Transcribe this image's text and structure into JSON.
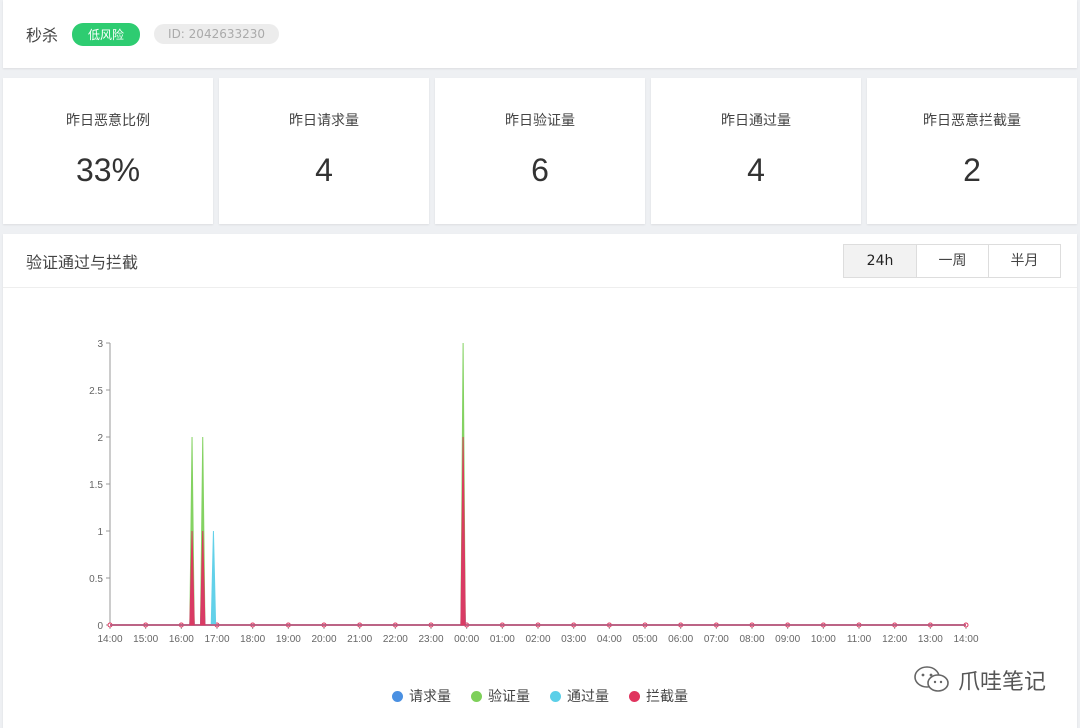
{
  "header": {
    "app_name": "秒杀",
    "risk_label": "低风险",
    "id_label": "ID: 2042633230"
  },
  "stats": [
    {
      "label": "昨日恶意比例",
      "value": "33%"
    },
    {
      "label": "昨日请求量",
      "value": "4"
    },
    {
      "label": "昨日验证量",
      "value": "6"
    },
    {
      "label": "昨日通过量",
      "value": "4"
    },
    {
      "label": "昨日恶意拦截量",
      "value": "2"
    }
  ],
  "chart_panel": {
    "title": "验证通过与拦截",
    "tabs": [
      "24h",
      "一周",
      "半月"
    ],
    "active_tab": "24h"
  },
  "colors": {
    "request": "#4a90e2",
    "verify": "#7ed05a",
    "pass": "#5bcfe8",
    "block": "#e0345e",
    "risk_badge": "#2ecc71"
  },
  "chart_data": {
    "type": "area",
    "x_ticks": [
      "14:00",
      "15:00",
      "16:00",
      "17:00",
      "18:00",
      "19:00",
      "20:00",
      "21:00",
      "22:00",
      "23:00",
      "00:00",
      "01:00",
      "02:00",
      "03:00",
      "04:00",
      "05:00",
      "06:00",
      "07:00",
      "08:00",
      "09:00",
      "10:00",
      "11:00",
      "12:00",
      "13:00",
      "14:00"
    ],
    "y_ticks": [
      "0",
      "0.5",
      "1",
      "1.5",
      "2",
      "2.5",
      "3"
    ],
    "ylim": [
      0,
      3
    ],
    "series": [
      {
        "name": "请求量",
        "color_key": "request",
        "points": [
          [
            16.3,
            0.5
          ],
          [
            16.6,
            0.5
          ],
          [
            23.9,
            1
          ]
        ]
      },
      {
        "name": "验证量",
        "color_key": "verify",
        "points": [
          [
            16.3,
            2
          ],
          [
            16.6,
            2
          ],
          [
            23.9,
            3
          ]
        ]
      },
      {
        "name": "通过量",
        "color_key": "pass",
        "points": [
          [
            16.3,
            0.5
          ],
          [
            16.6,
            0.5
          ],
          [
            16.9,
            1
          ],
          [
            23.9,
            1
          ]
        ]
      },
      {
        "name": "拦截量",
        "color_key": "block",
        "points": [
          [
            16.3,
            1
          ],
          [
            16.6,
            1
          ],
          [
            23.9,
            2
          ]
        ]
      }
    ],
    "legend_position": "bottom"
  },
  "watermark": {
    "text": "爪哇笔记",
    "icon": "wechat-icon"
  }
}
